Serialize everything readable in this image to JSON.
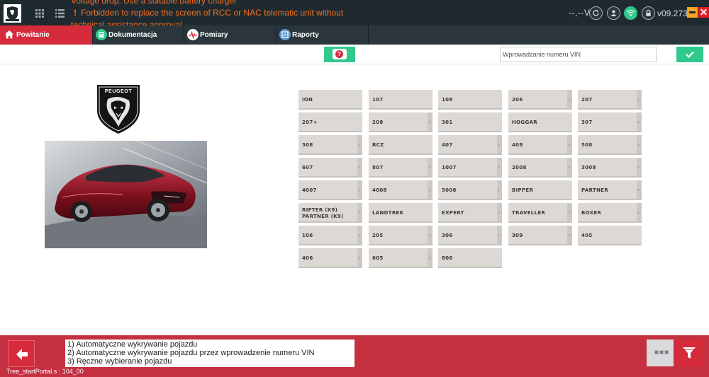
{
  "window": {
    "messages": [
      "Voltage drop. Use a suitable battery charger",
      "Forbidden to replace the screen of RCC or NAC telematic unit without",
      "technical assistance approval"
    ],
    "warning_glyph": "!",
    "voltage": "--,--V",
    "version": "v09.273",
    "close_glyph": "✕"
  },
  "tabs": [
    {
      "label": "Powitanie",
      "icon": "home-icon",
      "active": true
    },
    {
      "label": "Dokumentacja",
      "icon": "documentation-icon",
      "active": false
    },
    {
      "label": "Pomiary",
      "icon": "measurement-icon",
      "active": false
    },
    {
      "label": "Raporty",
      "icon": "reports-icon",
      "active": false
    }
  ],
  "vin": {
    "placeholder": "Wprowadzanie numeru VIN",
    "value": ""
  },
  "vehicle_id_badge": "?",
  "brand": {
    "name": "PEUGEOT"
  },
  "models": [
    {
      "label": "iON",
      "sub": false
    },
    {
      "label": "107",
      "sub": false
    },
    {
      "label": "108",
      "sub": false
    },
    {
      "label": "206",
      "sub": true
    },
    {
      "label": "207",
      "sub": true
    },
    {
      "label": "207+",
      "sub": false
    },
    {
      "label": "208",
      "sub": true
    },
    {
      "label": "301",
      "sub": false
    },
    {
      "label": "HOGGAR",
      "sub": false
    },
    {
      "label": "307",
      "sub": true
    },
    {
      "label": "308",
      "sub": true
    },
    {
      "label": "RCZ",
      "sub": false
    },
    {
      "label": "407",
      "sub": true
    },
    {
      "label": "408",
      "sub": true
    },
    {
      "label": "508",
      "sub": true
    },
    {
      "label": "607",
      "sub": true
    },
    {
      "label": "807",
      "sub": true
    },
    {
      "label": "1007",
      "sub": true
    },
    {
      "label": "2008",
      "sub": true
    },
    {
      "label": "3008",
      "sub": true
    },
    {
      "label": "4007",
      "sub": true
    },
    {
      "label": "4008",
      "sub": true
    },
    {
      "label": "5008",
      "sub": true
    },
    {
      "label": "BIPPER",
      "sub": false
    },
    {
      "label": "PARTNER",
      "sub": true
    },
    {
      "label": "RIFTER (K9) PARTNER (K9)",
      "sub": true
    },
    {
      "label": "LANDTREK",
      "sub": false
    },
    {
      "label": "EXPERT",
      "sub": true
    },
    {
      "label": "TRAVELLER",
      "sub": true
    },
    {
      "label": "BOXER",
      "sub": true
    },
    {
      "label": "106",
      "sub": true
    },
    {
      "label": "205",
      "sub": true
    },
    {
      "label": "306",
      "sub": true
    },
    {
      "label": "309",
      "sub": true
    },
    {
      "label": "405",
      "sub": false
    },
    {
      "label": "406",
      "sub": true
    },
    {
      "label": "605",
      "sub": true
    },
    {
      "label": "806",
      "sub": false
    }
  ],
  "info": {
    "lines": [
      "1) Automatyczne wykrywanie pojazdu",
      "2) Automatyczne wykrywanie pojazdu przez wprowadzenie numeru VIN",
      "3) Ręczne wybieranie pojazdu"
    ]
  },
  "more_glyph": "■■■",
  "status_code": "Tree_startPortal.s : 104_00",
  "colors": {
    "accent_red": "#d52b3b",
    "accent_green": "#2fc98c",
    "topbar": "#1f2a30",
    "message_orange": "#f36f21",
    "tile": "#dcd8d4"
  }
}
